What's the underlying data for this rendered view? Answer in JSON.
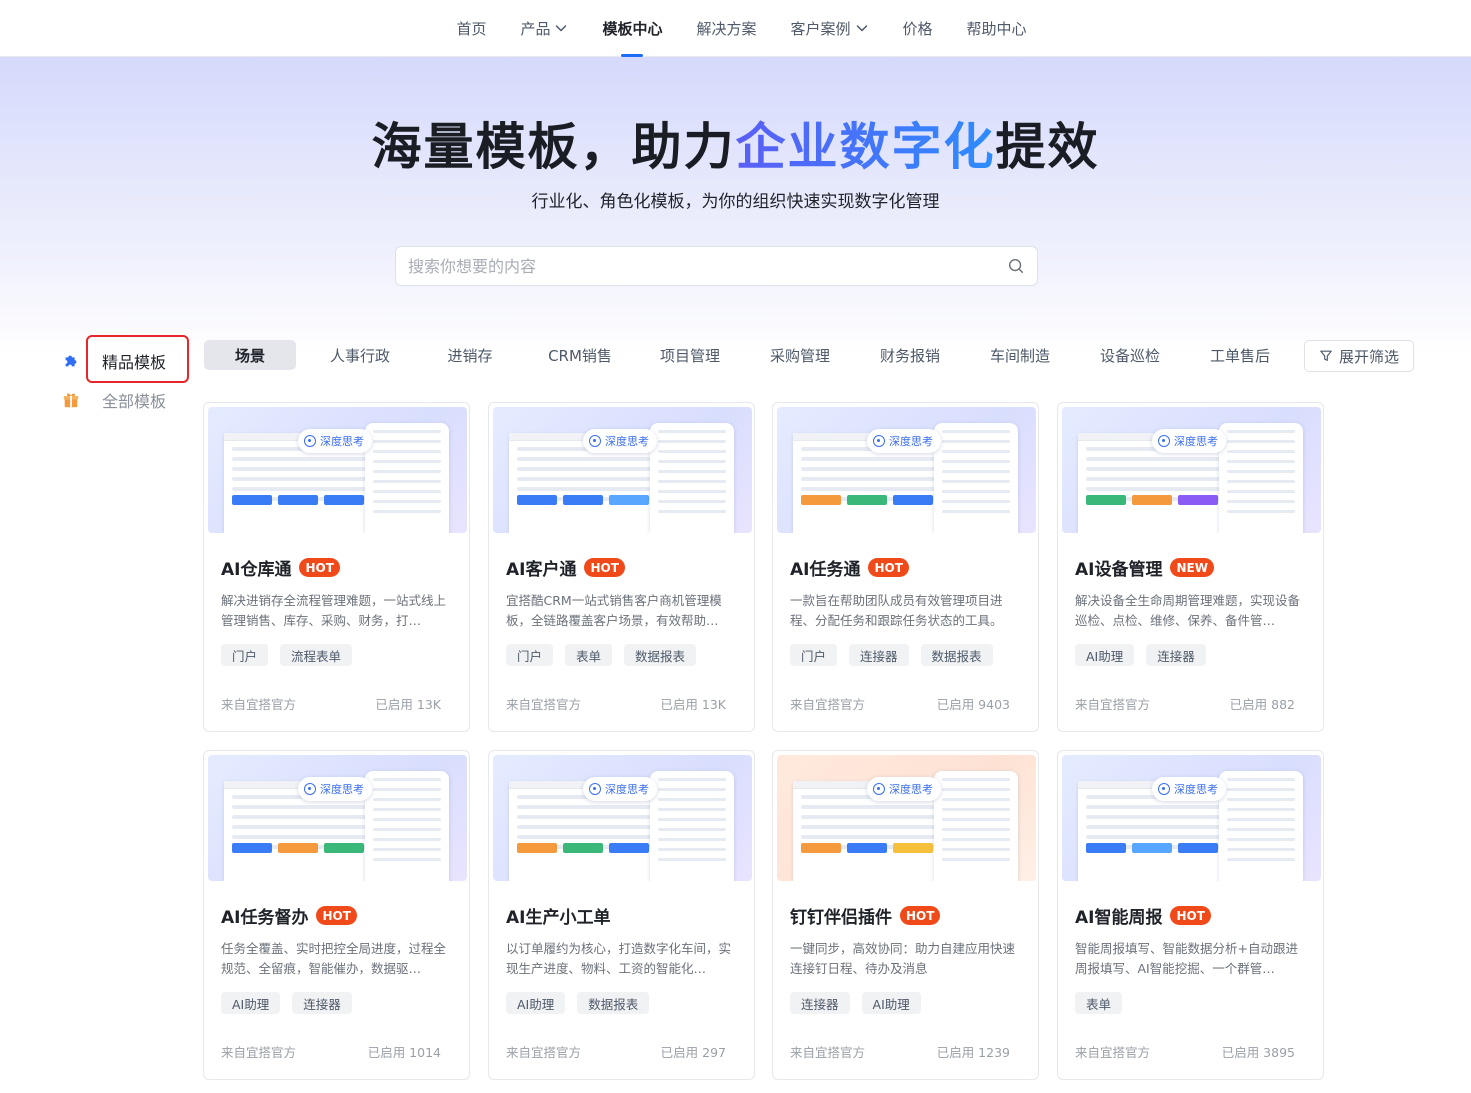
{
  "nav": {
    "items": [
      {
        "label": "首页",
        "dropdown": false,
        "active": false
      },
      {
        "label": "产品",
        "dropdown": true,
        "active": false
      },
      {
        "label": "模板中心",
        "dropdown": false,
        "active": true
      },
      {
        "label": "解决方案",
        "dropdown": false,
        "active": false
      },
      {
        "label": "客户案例",
        "dropdown": true,
        "active": false
      },
      {
        "label": "价格",
        "dropdown": false,
        "active": false
      },
      {
        "label": "帮助中心",
        "dropdown": false,
        "active": false
      }
    ]
  },
  "hero": {
    "title_pre": "海量模板，助力",
    "title_highlight": "企业数字化",
    "title_post": "提效",
    "subtitle": "行业化、角色化模板，为你的组织快速实现数字化管理"
  },
  "search": {
    "placeholder": "搜索你想要的内容",
    "value": ""
  },
  "sidebar": {
    "items": [
      {
        "label": "精品模板",
        "icon": "puzzle-icon",
        "active": true
      },
      {
        "label": "全部模板",
        "icon": "gift-icon",
        "active": false
      }
    ]
  },
  "tabs": [
    {
      "label": "场景",
      "active": true
    },
    {
      "label": "人事行政",
      "active": false
    },
    {
      "label": "进销存",
      "active": false
    },
    {
      "label": "CRM销售",
      "active": false
    },
    {
      "label": "项目管理",
      "active": false
    },
    {
      "label": "采购管理",
      "active": false
    },
    {
      "label": "财务报销",
      "active": false
    },
    {
      "label": "车间制造",
      "active": false
    },
    {
      "label": "设备巡检",
      "active": false
    },
    {
      "label": "工单售后",
      "active": false
    }
  ],
  "filter": {
    "label": "展开筛选",
    "icon": "funnel-icon"
  },
  "thumb_chip_label": "深度思考",
  "colors": {
    "accent": "#1f6cf5",
    "badge": "#f04a1a",
    "highlight_border": "#e5262a"
  },
  "cards": [
    {
      "title": "AI仓库通",
      "badge": "HOT",
      "desc": "解决进销存全流程管理难题，一站式线上管理销售、库存、采购、财务，打…",
      "tags": [
        "门户",
        "流程表单"
      ],
      "source": "来自宜搭官方",
      "usage": "已启用 13K"
    },
    {
      "title": "AI客户通",
      "badge": "HOT",
      "desc": "宜搭酷CRM一站式销售客户商机管理模板，全链路覆盖客户场景，有效帮助…",
      "tags": [
        "门户",
        "表单",
        "数据报表"
      ],
      "source": "来自宜搭官方",
      "usage": "已启用 13K"
    },
    {
      "title": "AI任务通",
      "badge": "HOT",
      "desc": "一款旨在帮助团队成员有效管理项目进程、分配任务和跟踪任务状态的工具。",
      "tags": [
        "门户",
        "连接器",
        "数据报表"
      ],
      "source": "来自宜搭官方",
      "usage": "已启用 9403"
    },
    {
      "title": "AI设备管理",
      "badge": "NEW",
      "desc": "解决设备全生命周期管理难题，实现设备巡检、点检、维修、保养、备件管…",
      "tags": [
        "AI助理",
        "连接器"
      ],
      "source": "来自宜搭官方",
      "usage": "已启用 882"
    },
    {
      "title": "AI任务督办",
      "badge": "HOT",
      "desc": "任务全覆盖、实时把控全局进度，过程全规范、全留痕，智能催办，数据驱…",
      "tags": [
        "AI助理",
        "连接器"
      ],
      "source": "来自宜搭官方",
      "usage": "已启用 1014"
    },
    {
      "title": "AI生产小工单",
      "badge": "",
      "desc": "以订单履约为核心，打造数字化车间，实现生产进度、物料、工资的智能化…",
      "tags": [
        "AI助理",
        "数据报表"
      ],
      "source": "来自宜搭官方",
      "usage": "已启用 297"
    },
    {
      "title": "钉钉伴侣插件",
      "badge": "HOT",
      "desc": "一键同步，高效协同：助力自建应用快速连接钉日程、待办及消息",
      "tags": [
        "连接器",
        "AI助理"
      ],
      "source": "来自宜搭官方",
      "usage": "已启用 1239"
    },
    {
      "title": "AI智能周报",
      "badge": "HOT",
      "desc": "智能周报填写、智能数据分析+自动跟进周报填写、AI智能挖掘、一个群管…",
      "tags": [
        "表单"
      ],
      "source": "来自宜搭官方",
      "usage": "已启用 3895"
    }
  ]
}
